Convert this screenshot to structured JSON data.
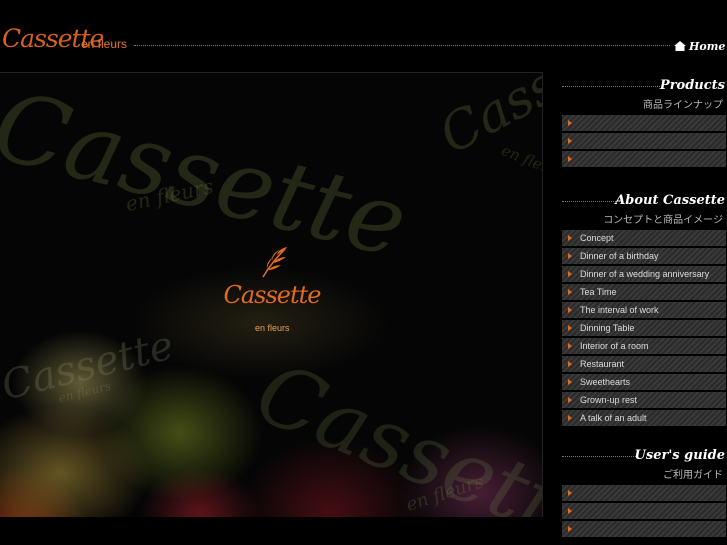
{
  "header": {
    "logo_script": "Cassette",
    "logo_sub": "en fleurs",
    "home_label": "Home"
  },
  "hero": {
    "logo_script": "Cassette",
    "logo_sub": "en fleurs",
    "watermark_big": "Cassette",
    "watermark_small": "en fleurs"
  },
  "sidebar": {
    "products": {
      "title": "Products",
      "subtitle": "商品ラインナップ",
      "items": [
        "",
        "",
        ""
      ]
    },
    "about": {
      "title": "About Cassette",
      "subtitle": "コンセプトと商品イメージ",
      "items": [
        "Concept",
        "Dinner of a birthday",
        "Dinner of a wedding anniversary",
        "Tea Time",
        "The interval of work",
        "Dinning Table",
        "Interior of a room",
        "Restaurant",
        "Sweethearts",
        "Grown-up rest",
        "A talk of an adult"
      ]
    },
    "guide": {
      "title": "User's guide",
      "subtitle": "ご利用ガイド",
      "items": [
        "",
        "",
        ""
      ]
    }
  },
  "colors": {
    "accent": "#e06a1e",
    "background": "#000000"
  },
  "icons": {
    "home": "home-icon",
    "menu_bullet": "triangle-right-icon",
    "logo_leaf": "leaf-icon"
  }
}
